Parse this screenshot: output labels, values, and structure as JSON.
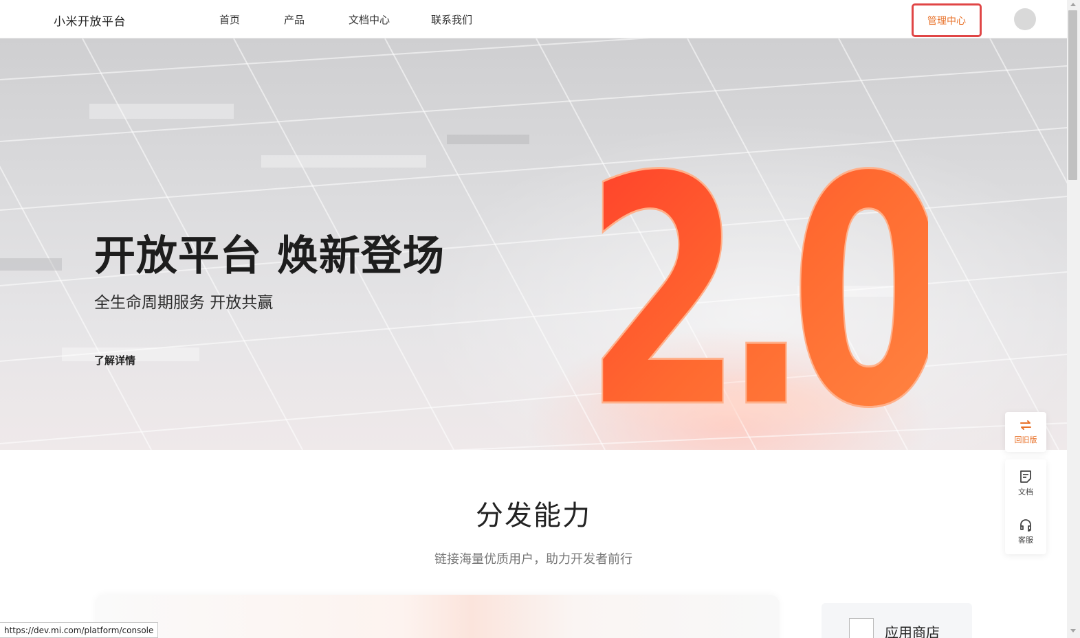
{
  "header": {
    "logo": "小米开放平台",
    "nav": [
      {
        "label": "首页"
      },
      {
        "label": "产品"
      },
      {
        "label": "文档中心"
      },
      {
        "label": "联系我们"
      }
    ],
    "admin_label": "管理中心"
  },
  "hero": {
    "title": "开放平台 焕新登场",
    "subtitle": "全生命周期服务 开放共赢",
    "link": "了解详情",
    "badge": "2.0"
  },
  "section": {
    "title": "分发能力",
    "subtitle": "链接海量优质用户，助力开发者前行",
    "card_label": "应用商店"
  },
  "float_bar": {
    "old_version": "回旧版",
    "docs": "文档",
    "service": "客服"
  },
  "status_url": "https://dev.mi.com/platform/console",
  "colors": {
    "accent": "#e8722a",
    "admin_border": "#e04646",
    "badge_orange": "#ff5a1f"
  }
}
